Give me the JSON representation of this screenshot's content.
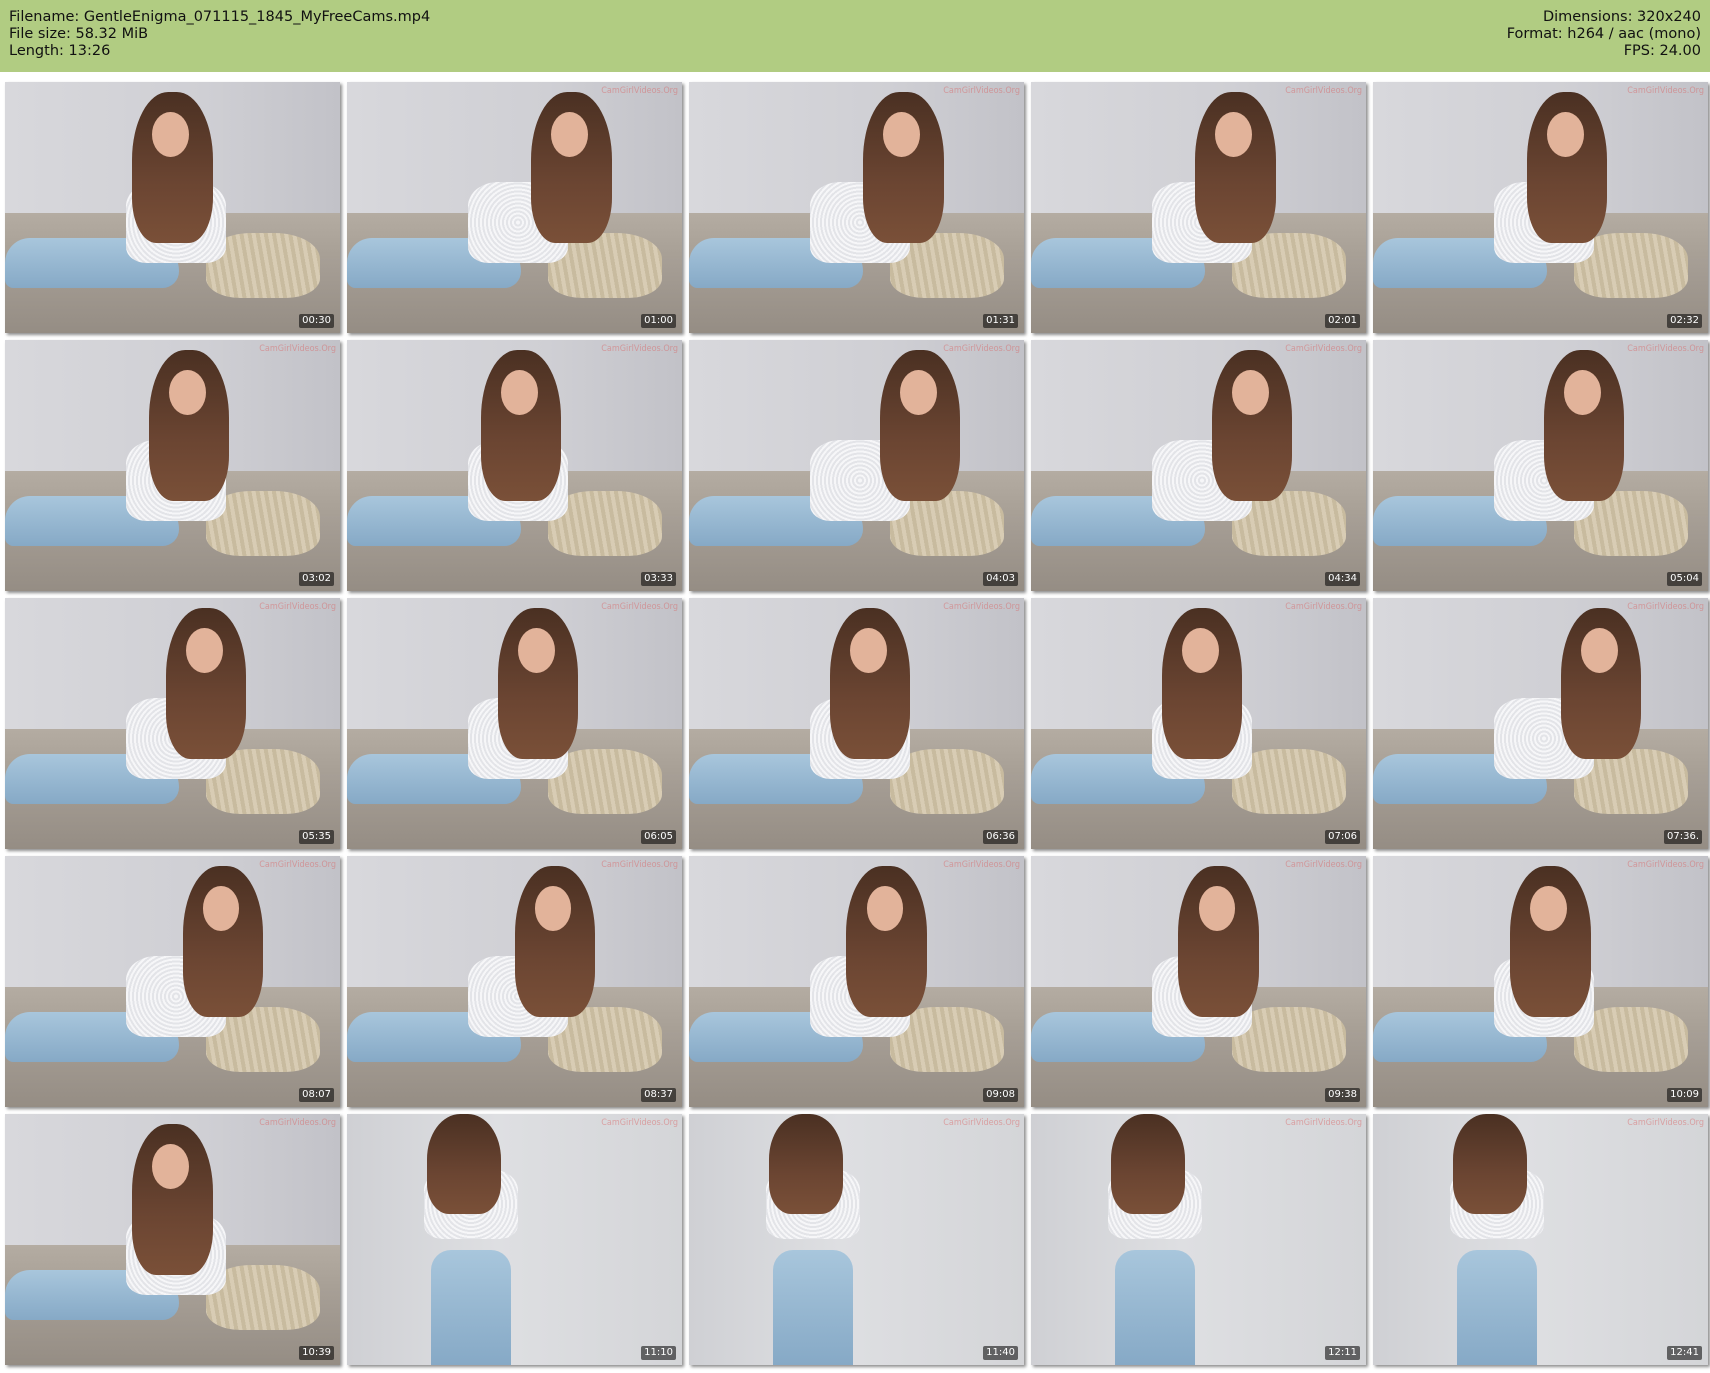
{
  "header": {
    "left": [
      "Filename: GentleEnigma_071115_1845_MyFreeCams.mp4",
      "File size: 58.32 MiB",
      "Length: 13:26"
    ],
    "right": [
      "Dimensions: 320x240",
      "Format: h264 / aac (mono)",
      "FPS: 24.00"
    ]
  },
  "watermark_text": "CamGirlVideos.Org",
  "thumbnails": [
    {
      "time": "00:30",
      "scene": "sofa"
    },
    {
      "time": "01:00",
      "scene": "sofa"
    },
    {
      "time": "01:31",
      "scene": "sofa"
    },
    {
      "time": "02:01",
      "scene": "sofa"
    },
    {
      "time": "02:32",
      "scene": "sofa"
    },
    {
      "time": "03:02",
      "scene": "sofa"
    },
    {
      "time": "03:33",
      "scene": "sofa"
    },
    {
      "time": "04:03",
      "scene": "sofa"
    },
    {
      "time": "04:34",
      "scene": "sofa"
    },
    {
      "time": "05:04",
      "scene": "sofa"
    },
    {
      "time": "05:35",
      "scene": "sofa"
    },
    {
      "time": "06:05",
      "scene": "sofa"
    },
    {
      "time": "06:36",
      "scene": "sofa"
    },
    {
      "time": "07:06",
      "scene": "sofa"
    },
    {
      "time": "07:36.",
      "scene": "sofa"
    },
    {
      "time": "08:07",
      "scene": "sofa"
    },
    {
      "time": "08:37",
      "scene": "sofa"
    },
    {
      "time": "09:08",
      "scene": "sofa"
    },
    {
      "time": "09:38",
      "scene": "sofa"
    },
    {
      "time": "10:09",
      "scene": "sofa"
    },
    {
      "time": "10:39",
      "scene": "sofa"
    },
    {
      "time": "11:10",
      "scene": "standing"
    },
    {
      "time": "11:40",
      "scene": "standing"
    },
    {
      "time": "12:11",
      "scene": "standing"
    },
    {
      "time": "12:41",
      "scene": "standing"
    }
  ],
  "colors": {
    "header_bg": "#b1cc82",
    "page_bg": "#ffffff",
    "timestamp_bg": "#000000"
  }
}
